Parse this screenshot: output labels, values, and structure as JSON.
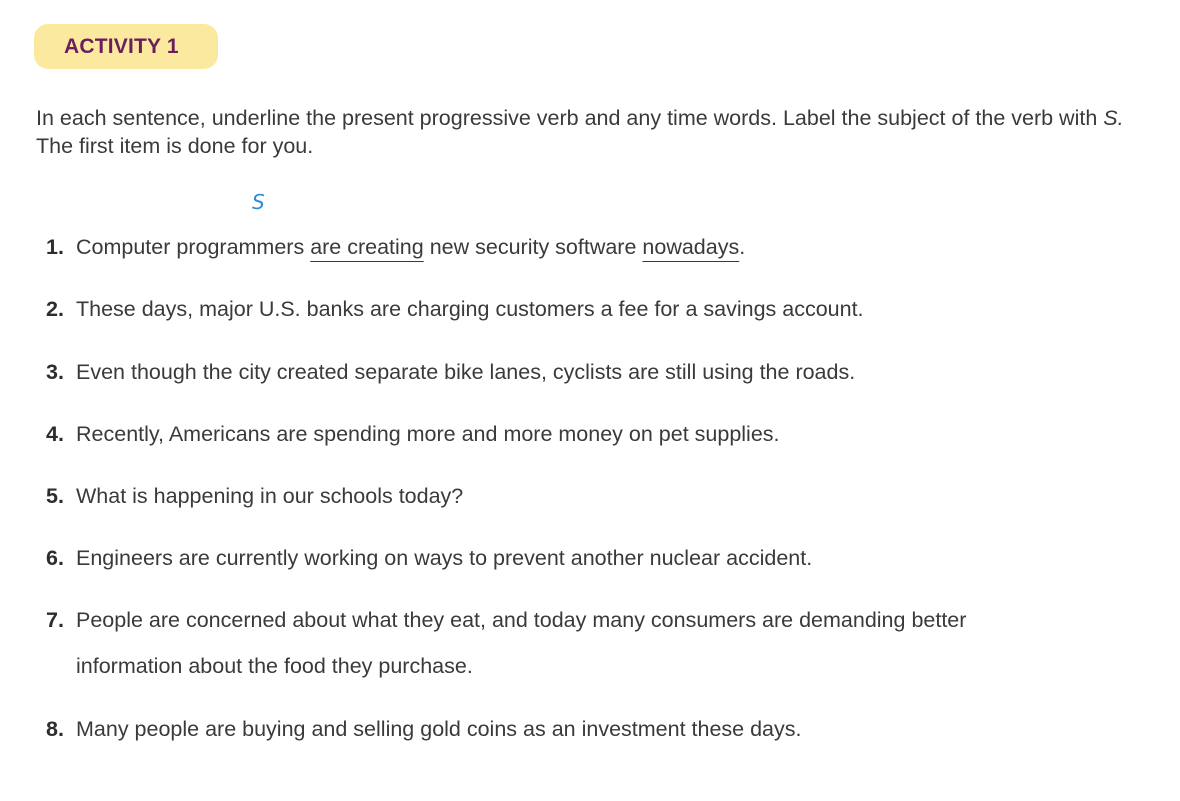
{
  "header": {
    "activity_label": "ACTIVITY 1"
  },
  "instructions": {
    "part1": "In each sentence, underline the present progressive verb and any time words. Label the subject of the verb with ",
    "subject_marker": "S.",
    "part2": " The first item is done for you."
  },
  "example_annotation": {
    "subject_label": "S"
  },
  "items": [
    {
      "number": "1.",
      "pre": "Computer programmers ",
      "verb": "are creating",
      "mid": " new security software ",
      "time": "nowadays",
      "post": "."
    },
    {
      "number": "2.",
      "text": "These days, major U.S. banks are charging customers a fee for a savings account."
    },
    {
      "number": "3.",
      "text": "Even though the city created separate bike lanes, cyclists are still using the roads."
    },
    {
      "number": "4.",
      "text": "Recently, Americans are spending more and more money on pet supplies."
    },
    {
      "number": "5.",
      "text": "What is happening in our schools today?"
    },
    {
      "number": "6.",
      "text": "Engineers are currently working on ways to prevent another nuclear accident."
    },
    {
      "number": "7.",
      "text": "People are concerned about what they eat, and today many consumers are demanding better",
      "text_cont": "information about the food they purchase."
    },
    {
      "number": "8.",
      "text": "Many people are buying and selling gold coins as an investment these days."
    }
  ],
  "colors": {
    "badge_bg": "#fbe9a0",
    "badge_text": "#6b1e5c",
    "annotation_blue": "#2a8fd0",
    "body_text": "#3a3a3a"
  }
}
